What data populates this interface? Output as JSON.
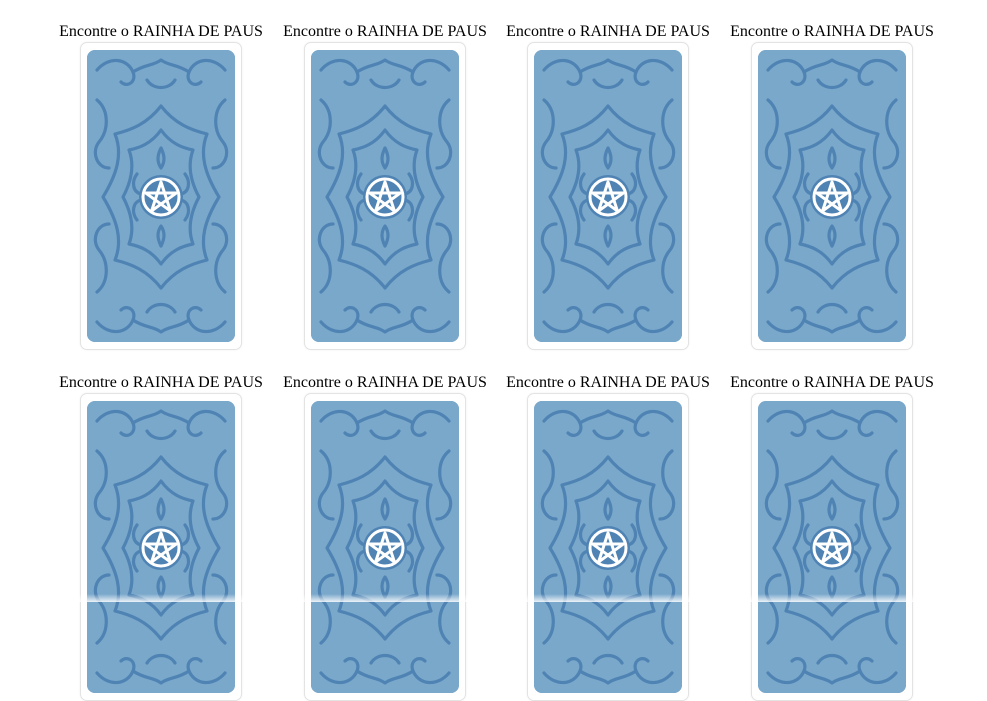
{
  "cards": [
    {
      "caption": "Encontre o RAINHA DE PAUS"
    },
    {
      "caption": "Encontre o RAINHA DE PAUS"
    },
    {
      "caption": "Encontre o RAINHA DE PAUS"
    },
    {
      "caption": "Encontre o RAINHA DE PAUS"
    },
    {
      "caption": "Encontre o RAINHA DE PAUS"
    },
    {
      "caption": "Encontre o RAINHA DE PAUS"
    },
    {
      "caption": "Encontre o RAINHA DE PAUS"
    },
    {
      "caption": "Encontre o RAINHA DE PAUS"
    }
  ],
  "card_back": {
    "icon": "pentacle-icon",
    "fill_color": "#7aa8cb",
    "pattern_color": "#4f83b3",
    "emblem_color": "#ffffff"
  }
}
